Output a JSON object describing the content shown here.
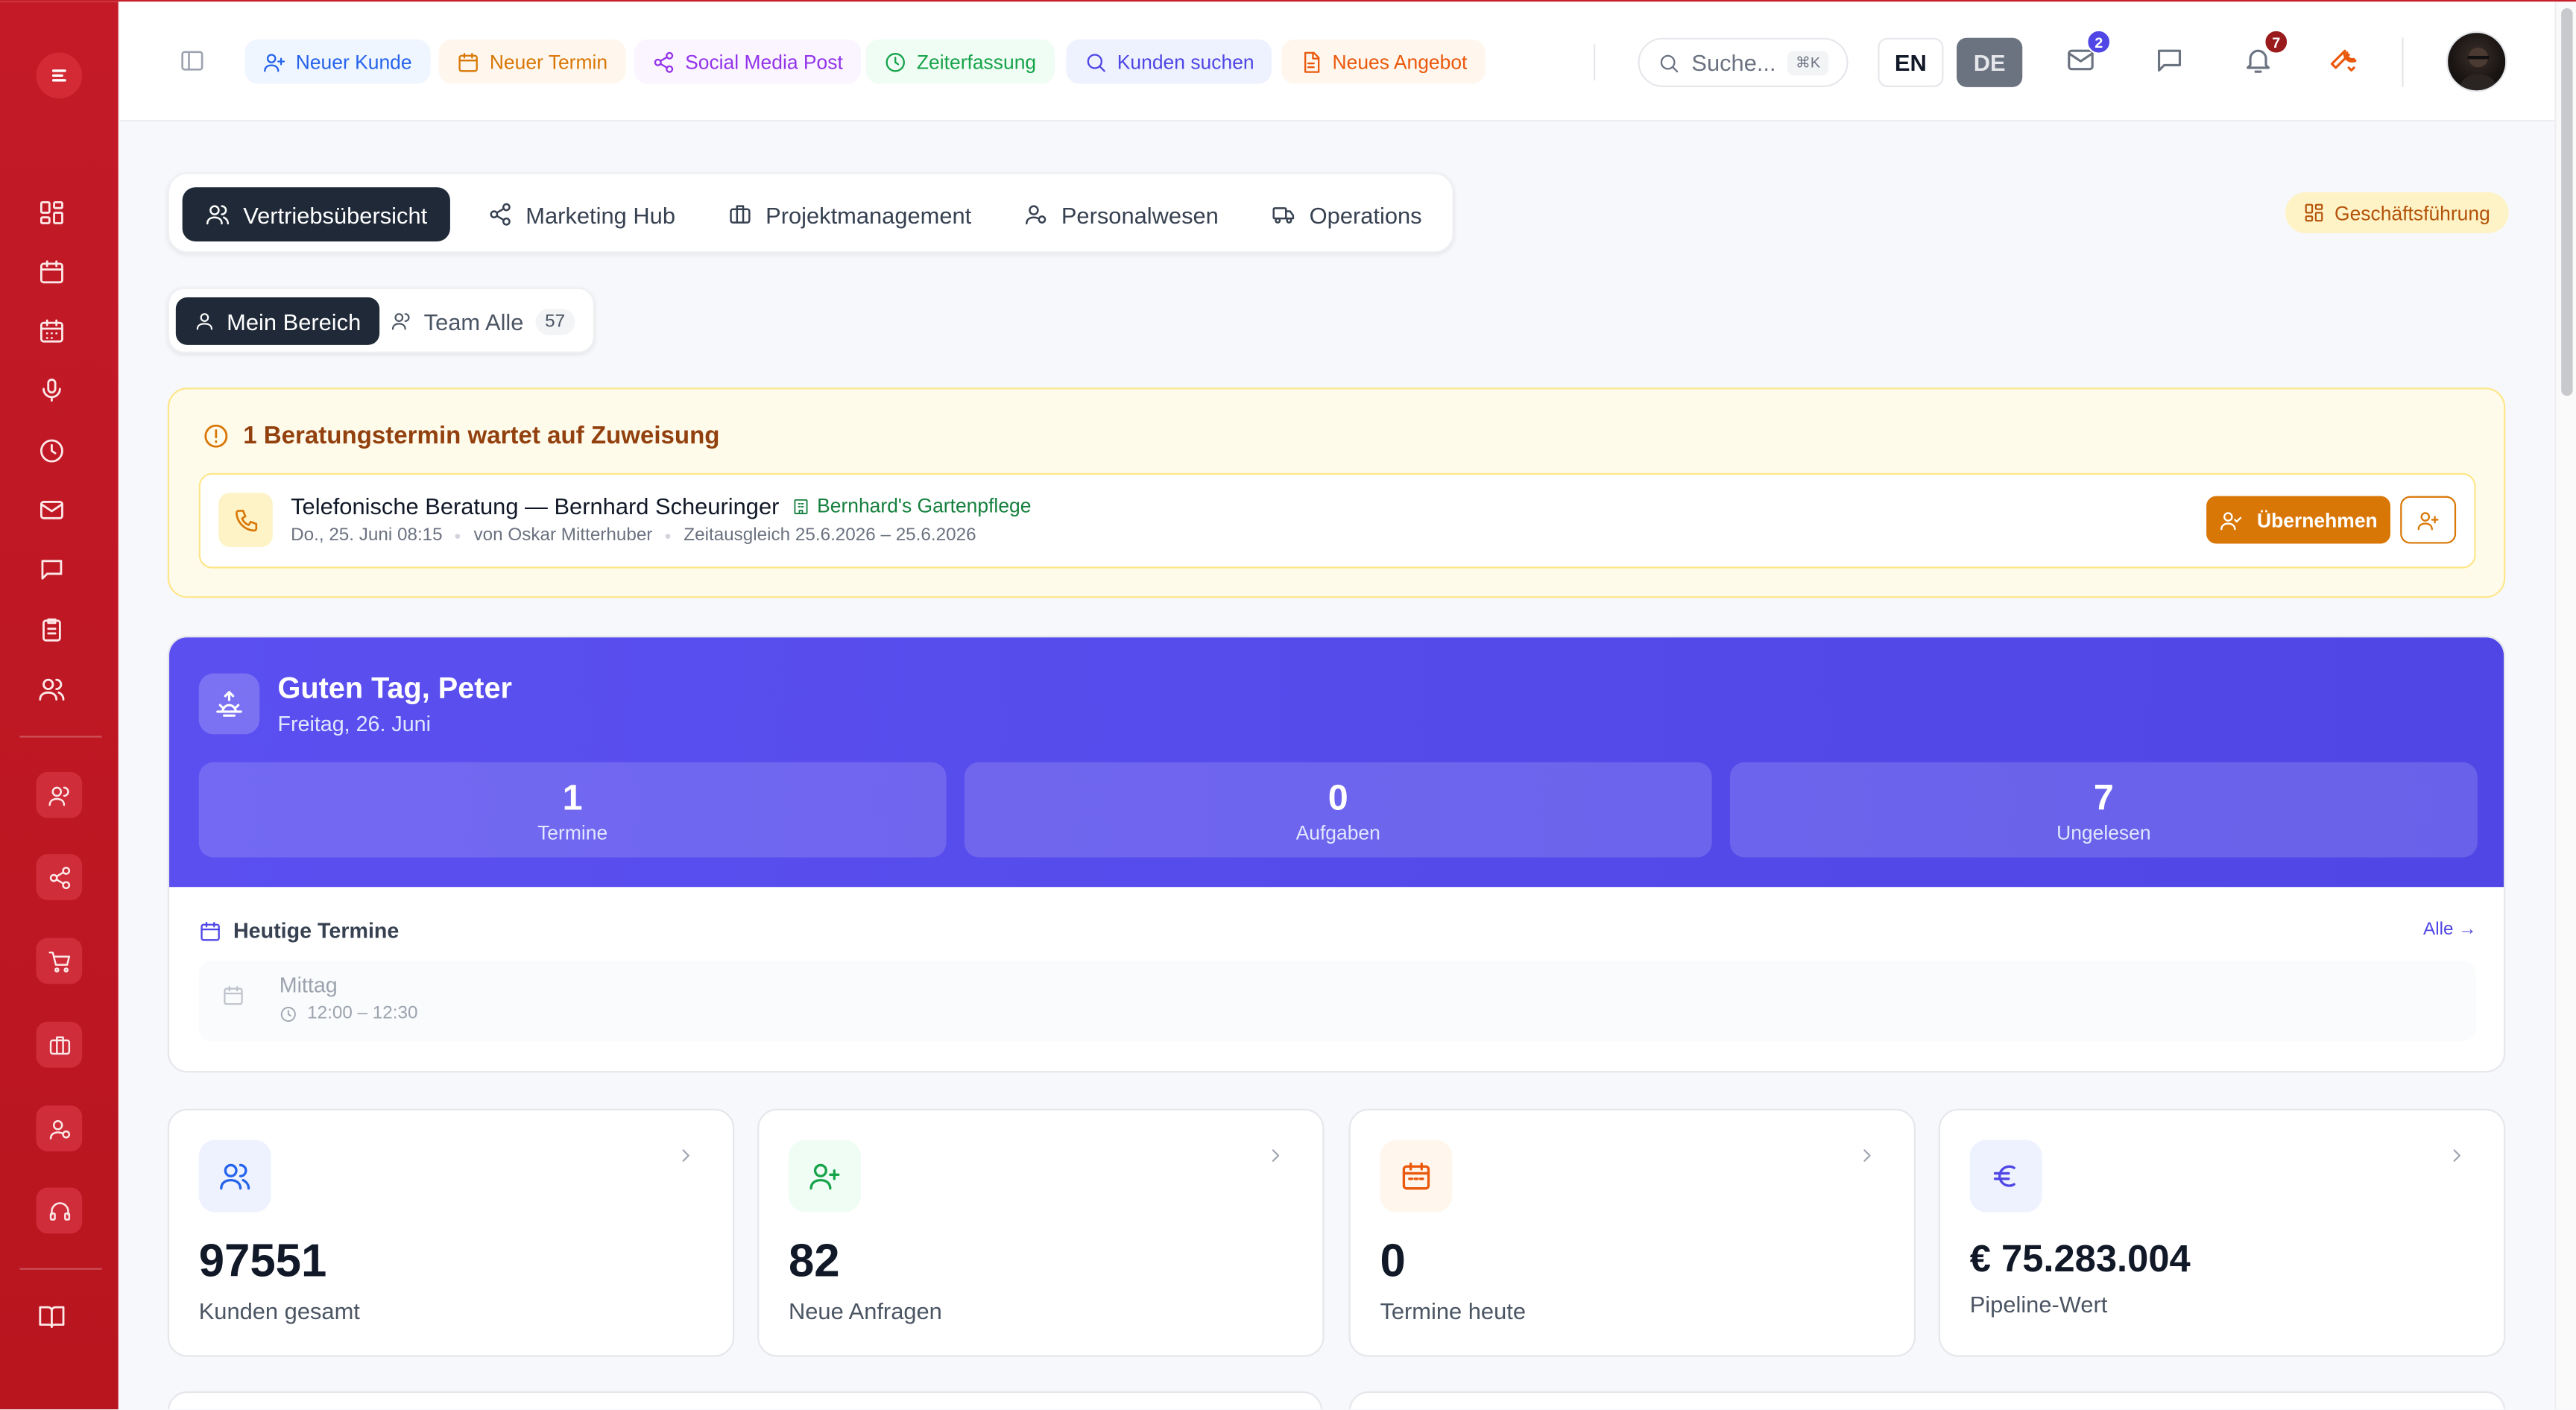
{
  "topbar": {
    "quick_actions": [
      {
        "label": "Neuer Kunde",
        "icon": "user-plus-icon",
        "color": "#2563eb",
        "bg": "#eff6ff"
      },
      {
        "label": "Neuer Termin",
        "icon": "calendar-icon",
        "color": "#d97706",
        "bg": "#fff7ed"
      },
      {
        "label": "Social Media Post",
        "icon": "share-icon",
        "color": "#9333ea",
        "bg": "#faf5ff"
      },
      {
        "label": "Zeiterfassung",
        "icon": "clock-icon",
        "color": "#16a34a",
        "bg": "#f0fdf4"
      },
      {
        "label": "Kunden suchen",
        "icon": "search-icon",
        "color": "#4f46e5",
        "bg": "#eef2ff"
      },
      {
        "label": "Neues Angebot",
        "icon": "document-icon",
        "color": "#ea580c",
        "bg": "#fff7ed"
      }
    ],
    "search_placeholder": "Suche...",
    "search_shortcut": "⌘K",
    "languages": [
      "EN",
      "DE"
    ],
    "active_language": "DE",
    "mail_badge": "2",
    "notification_badge": "7"
  },
  "tabs": [
    "Vertriebsübersicht",
    "Marketing Hub",
    "Projektmanagement",
    "Personalwesen",
    "Operations"
  ],
  "role_badge": "Geschäftsführung",
  "subtabs": {
    "mine": "Mein Bereich",
    "team": "Team Alle",
    "team_count": "57"
  },
  "alert": {
    "title": "1 Beratungstermin wartet auf Zuweisung",
    "item_title": "Telefonische Beratung — Bernhard Scheuringer",
    "company": "Bernhard's Gartenpflege",
    "date": "Do., 25. Juni 08:15",
    "author": "von Oskar Mitterhuber",
    "range": "Zeitausgleich 25.6.2026 – 25.6.2026",
    "take_label": "Übernehmen"
  },
  "greeting": {
    "title": "Guten Tag, Peter",
    "date": "Freitag, 26. Juni",
    "stats": [
      {
        "value": "1",
        "label": "Termine"
      },
      {
        "value": "0",
        "label": "Aufgaben"
      },
      {
        "value": "7",
        "label": "Ungelesen"
      }
    ],
    "today_title": "Heutige Termine",
    "all_link": "Alle →",
    "event": {
      "title": "Mittag",
      "time": "12:00 – 12:30"
    }
  },
  "kpis": [
    {
      "value": "97551",
      "label": "Kunden gesamt",
      "icon": "users-icon",
      "color": "#2563eb",
      "bg": "#eef2ff"
    },
    {
      "value": "82",
      "label": "Neue Anfragen",
      "icon": "user-plus-icon",
      "color": "#16a34a",
      "bg": "#f0fdf4"
    },
    {
      "value": "0",
      "label": "Termine heute",
      "icon": "calendar-icon",
      "color": "#ea580c",
      "bg": "#fff7ed"
    },
    {
      "value": "€ 75.283.004",
      "label": "Pipeline-Wert",
      "icon": "euro-icon",
      "color": "#4f46e5",
      "bg": "#eef2ff"
    }
  ],
  "colors": {
    "sidebar": "#c41a28",
    "accent": "#4f46e5",
    "warning": "#d97706",
    "dark": "#1f2937"
  }
}
